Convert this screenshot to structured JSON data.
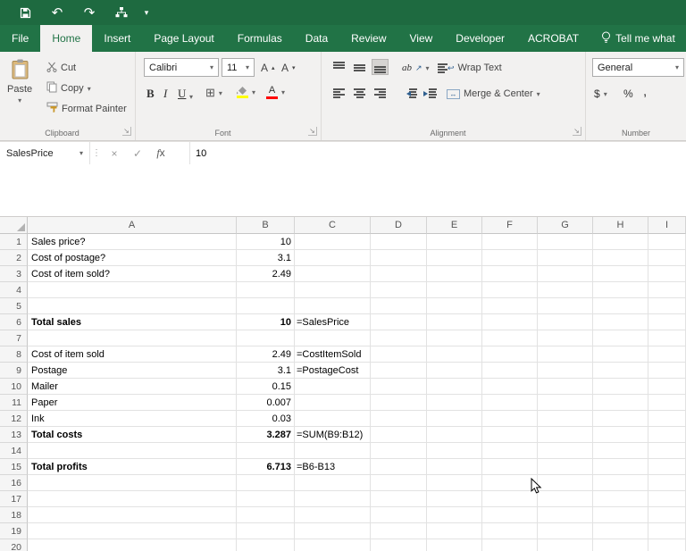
{
  "titlebar": {
    "quick_access": [
      "save",
      "undo",
      "redo",
      "org-chart",
      "customize"
    ]
  },
  "ribbon": {
    "tabs": [
      {
        "label": "File",
        "active": false
      },
      {
        "label": "Home",
        "active": true
      },
      {
        "label": "Insert",
        "active": false
      },
      {
        "label": "Page Layout",
        "active": false
      },
      {
        "label": "Formulas",
        "active": false
      },
      {
        "label": "Data",
        "active": false
      },
      {
        "label": "Review",
        "active": false
      },
      {
        "label": "View",
        "active": false
      },
      {
        "label": "Developer",
        "active": false
      },
      {
        "label": "ACROBAT",
        "active": false
      }
    ],
    "tell_me": "Tell me what",
    "clipboard": {
      "label": "Clipboard",
      "paste": "Paste",
      "cut": "Cut",
      "copy": "Copy",
      "format_painter": "Format Painter"
    },
    "font": {
      "label": "Font",
      "name": "Calibri",
      "size": "11",
      "bold": "B",
      "italic": "I",
      "underline": "U",
      "borders_glyph": "⊞"
    },
    "alignment": {
      "label": "Alignment",
      "wrap": "Wrap Text",
      "merge": "Merge & Center",
      "orientation": "ab"
    },
    "number": {
      "label": "Number",
      "format": "General",
      "currency": "$",
      "percent": "%",
      "comma": ","
    }
  },
  "formula_bar": {
    "name_box": "SalesPrice",
    "cancel": "×",
    "enter": "✓",
    "fx": "x",
    "value": "10"
  },
  "sheet": {
    "columns": [
      "A",
      "B",
      "C",
      "D",
      "E",
      "F",
      "G",
      "H",
      "I"
    ],
    "rows": [
      {
        "n": "1",
        "a": "Sales price?",
        "b": "10",
        "c": "",
        "bold": false
      },
      {
        "n": "2",
        "a": "Cost of postage?",
        "b": "3.1",
        "c": "",
        "bold": false
      },
      {
        "n": "3",
        "a": "Cost of item sold?",
        "b": "2.49",
        "c": "",
        "bold": false
      },
      {
        "n": "4",
        "a": "",
        "b": "",
        "c": "",
        "bold": false
      },
      {
        "n": "5",
        "a": "",
        "b": "",
        "c": "",
        "bold": false
      },
      {
        "n": "6",
        "a": "Total sales",
        "b": "10",
        "c": "=SalesPrice",
        "bold": true
      },
      {
        "n": "7",
        "a": "",
        "b": "",
        "c": "",
        "bold": false
      },
      {
        "n": "8",
        "a": "Cost of item sold",
        "b": "2.49",
        "c": "=CostItemSold",
        "bold": false
      },
      {
        "n": "9",
        "a": "Postage",
        "b": "3.1",
        "c": "=PostageCost",
        "bold": false
      },
      {
        "n": "10",
        "a": "Mailer",
        "b": "0.15",
        "c": "",
        "bold": false
      },
      {
        "n": "11",
        "a": "Paper",
        "b": "0.007",
        "c": "",
        "bold": false
      },
      {
        "n": "12",
        "a": "Ink",
        "b": "0.03",
        "c": "",
        "bold": false
      },
      {
        "n": "13",
        "a": "Total costs",
        "b": "3.287",
        "c": "=SUM(B9:B12)",
        "bold": true
      },
      {
        "n": "14",
        "a": "",
        "b": "",
        "c": "",
        "bold": false
      },
      {
        "n": "15",
        "a": "Total profits",
        "b": "6.713",
        "c": "=B6-B13",
        "bold": true
      },
      {
        "n": "16",
        "a": "",
        "b": "",
        "c": "",
        "bold": false
      },
      {
        "n": "17",
        "a": "",
        "b": "",
        "c": "",
        "bold": false
      },
      {
        "n": "18",
        "a": "",
        "b": "",
        "c": "",
        "bold": false
      },
      {
        "n": "19",
        "a": "",
        "b": "",
        "c": "",
        "bold": false
      },
      {
        "n": "20",
        "a": "",
        "b": "",
        "c": "",
        "bold": false
      }
    ]
  },
  "colors": {
    "excel_green": "#217346",
    "titlebar_green": "#1e6a40",
    "fill_yellow": "#ffff00",
    "font_red": "#ff0000"
  }
}
